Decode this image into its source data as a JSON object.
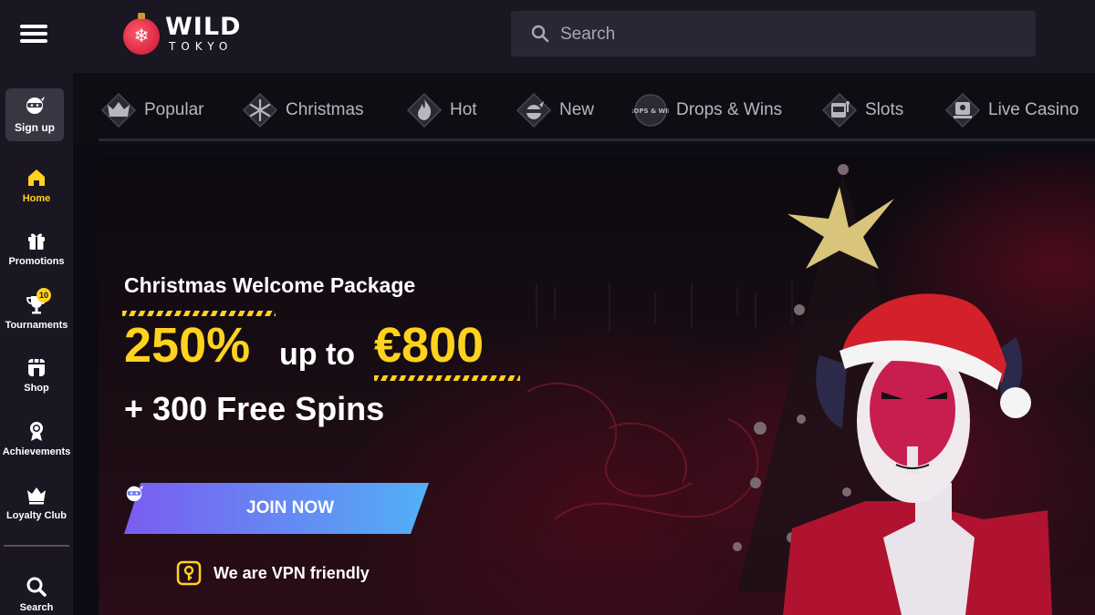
{
  "header": {
    "brand_top": "WILD",
    "brand_bottom": "TOKYO",
    "search_placeholder": "Search"
  },
  "sidebar": {
    "signup_label": "Sign up",
    "items": [
      {
        "label": "Home",
        "icon": "home-icon",
        "active": true
      },
      {
        "label": "Promotions",
        "icon": "gift-icon"
      },
      {
        "label": "Tournaments",
        "icon": "trophy-icon",
        "badge": "10"
      },
      {
        "label": "Shop",
        "icon": "shop-icon"
      },
      {
        "label": "Achievements",
        "icon": "medal-icon"
      },
      {
        "label": "Loyalty Club",
        "icon": "crown-icon"
      },
      {
        "label": "Search",
        "icon": "search-icon"
      }
    ]
  },
  "categories": [
    {
      "label": "Popular",
      "icon": "crown-icon"
    },
    {
      "label": "Christmas",
      "icon": "snowflake-icon"
    },
    {
      "label": "Hot",
      "icon": "flame-icon"
    },
    {
      "label": "New",
      "icon": "ninja-icon"
    },
    {
      "label": "Drops & Wins",
      "icon": "drops-wins-icon",
      "icon_text": "DROPS & WINS"
    },
    {
      "label": "Slots",
      "icon": "slot-machine-icon"
    },
    {
      "label": "Live Casino",
      "icon": "live-dealer-icon"
    }
  ],
  "banner": {
    "title": "Christmas Welcome Package",
    "percent": "250%",
    "up_to": "up to",
    "amount": "€800",
    "spins": "+ 300 Free Spins",
    "cta": "JOIN NOW",
    "vpn": "We are VPN friendly"
  },
  "colors": {
    "accent_yellow": "#ffd21f",
    "sidebar_bg": "#1a1622",
    "cta_gradient_start": "#7b5cf0",
    "cta_gradient_end": "#52b0f7"
  }
}
